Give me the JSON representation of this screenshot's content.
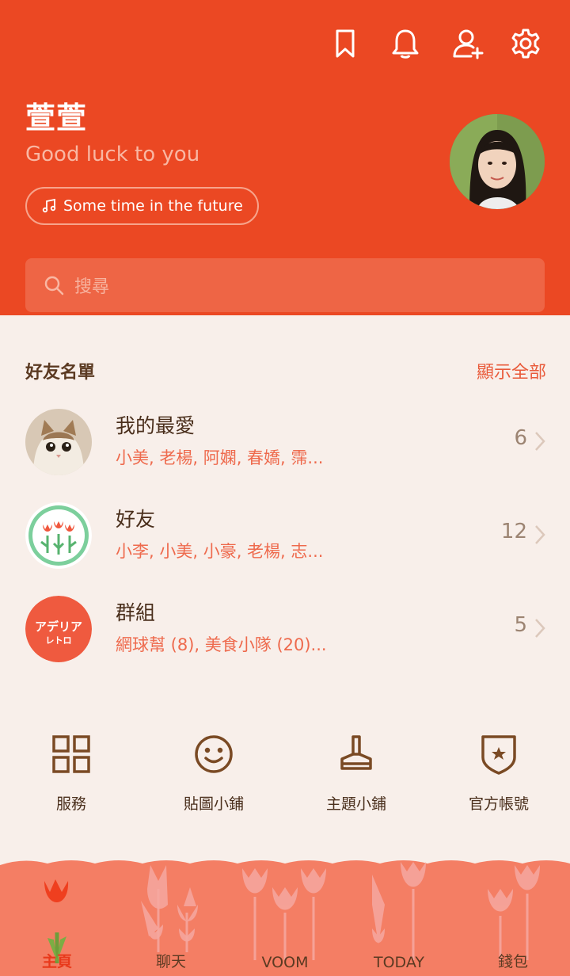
{
  "header": {
    "icons": [
      "bookmark-icon",
      "bell-icon",
      "add-friend-icon",
      "gear-icon"
    ],
    "profile_name": "萱萱",
    "status_message": "Good luck to you",
    "music": "Some time in the future",
    "search_placeholder": "搜尋"
  },
  "friends": {
    "title": "好友名單",
    "show_all": "顯示全部",
    "groups": [
      {
        "name": "我的最愛",
        "members": "小美, 老楊, 阿嫻, 春嬌, 霈...",
        "count": "6"
      },
      {
        "name": "好友",
        "members": "小李, 小美, 小豪, 老楊, 志...",
        "count": "12"
      },
      {
        "name": "群組",
        "members": "網球幫 (8), 美食小隊 (20)...",
        "count": "5"
      }
    ],
    "group_logo_text": [
      "アデリア",
      "レトロ"
    ]
  },
  "services": [
    {
      "label": "服務",
      "icon": "grid-icon"
    },
    {
      "label": "貼圖小鋪",
      "icon": "smiley-icon"
    },
    {
      "label": "主題小鋪",
      "icon": "brush-icon"
    },
    {
      "label": "官方帳號",
      "icon": "shield-star-icon"
    }
  ],
  "nav": [
    {
      "label": "主頁",
      "active": true
    },
    {
      "label": "聊天",
      "active": false
    },
    {
      "label": "VOOM",
      "active": false
    },
    {
      "label": "TODAY",
      "active": false
    },
    {
      "label": "錢包",
      "active": false
    }
  ],
  "colors": {
    "header": "#eb4823",
    "accent": "#e95a3a",
    "background": "#f8efea",
    "nav_bg": "#f47e64"
  }
}
